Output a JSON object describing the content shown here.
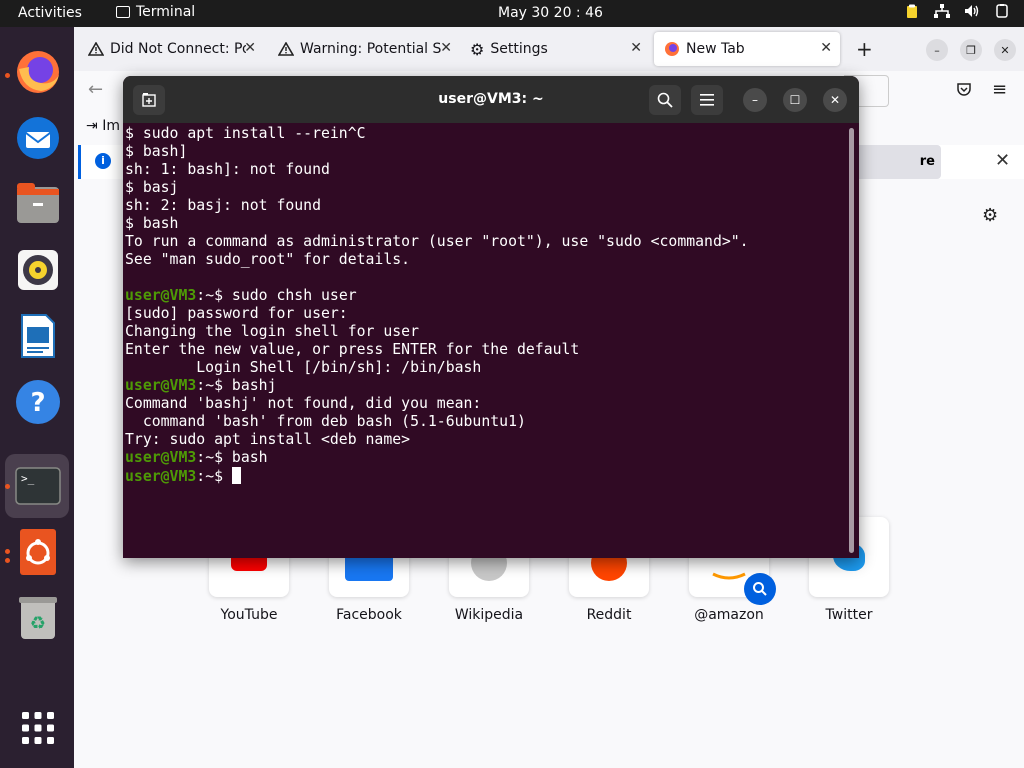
{
  "topbar": {
    "activities": "Activities",
    "app_name": "Terminal",
    "clock": "May 30  20 : 46"
  },
  "browser": {
    "tabs": [
      {
        "label": "Did Not Connect: Po"
      },
      {
        "label": "Warning: Potential S"
      },
      {
        "label": "Settings"
      },
      {
        "label": "New Tab"
      }
    ],
    "infobar_right": "re",
    "bookmark_partial": "Im"
  },
  "shortcuts": [
    {
      "label": "YouTube"
    },
    {
      "label": "Facebook"
    },
    {
      "label": "Wikipedia"
    },
    {
      "label": "Reddit"
    },
    {
      "label": "@amazon"
    },
    {
      "label": "Twitter"
    }
  ],
  "terminal": {
    "title": "user@VM3: ~",
    "lines": [
      "$ sudo apt install --rein^C",
      "$ bash]",
      "sh: 1: bash]: not found",
      "$ basj",
      "sh: 2: basj: not found",
      "$ bash",
      "To run a command as administrator (user \"root\"), use \"sudo <command>\".",
      "See \"man sudo_root\" for details.",
      "",
      "[sudo] password for user:",
      "Changing the login shell for user",
      "Enter the new value, or press ENTER for the default",
      "        Login Shell [/bin/sh]: /bin/bash",
      "Command 'bashj' not found, did you mean:",
      "  command 'bash' from deb bash (5.1-6ubuntu1)",
      "Try: sudo apt install <deb name>"
    ],
    "prompt": "user@VM3",
    "prompt_suffix": ":~",
    "cmd_chsh": "$ sudo chsh user",
    "cmd_bashj": "$ bashj",
    "cmd_bash": "$ bash",
    "cmd_last": "$ "
  },
  "colors": {
    "terminal_bg": "#300a24",
    "prompt_green": "#4e9a06",
    "ubuntu_orange": "#e95420",
    "firefox_blue": "#0060df"
  }
}
